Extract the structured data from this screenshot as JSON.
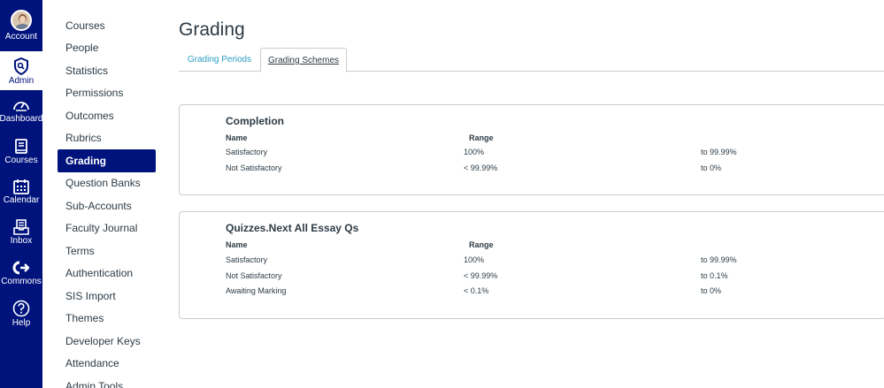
{
  "global_nav": {
    "account_label": "Account",
    "admin_label": "Admin",
    "dashboard_label": "Dashboard",
    "courses_label": "Courses",
    "calendar_label": "Calendar",
    "inbox_label": "Inbox",
    "commons_label": "Commons",
    "help_label": "Help"
  },
  "sub_nav": {
    "items": [
      "Courses",
      "People",
      "Statistics",
      "Permissions",
      "Outcomes",
      "Rubrics",
      "Grading",
      "Question Banks",
      "Sub-Accounts",
      "Faculty Journal",
      "Terms",
      "Authentication",
      "SIS Import",
      "Themes",
      "Developer Keys",
      "Attendance",
      "Admin Tools"
    ],
    "active": "Grading"
  },
  "page": {
    "title": "Grading"
  },
  "tabs": {
    "grading_periods": "Grading Periods",
    "grading_schemes": "Grading Schemes"
  },
  "schemes": [
    {
      "title": "Completion",
      "name_header": "Name",
      "range_header": "Range",
      "rows": [
        {
          "name": "Satisfactory",
          "min": "100%",
          "max": "to 99.99%"
        },
        {
          "name": "Not Satisfactory",
          "min": "< 99.99%",
          "max": "to 0%"
        }
      ]
    },
    {
      "title": "Quizzes.Next All Essay Qs",
      "name_header": "Name",
      "range_header": "Range",
      "rows": [
        {
          "name": "Satisfactory",
          "min": "100%",
          "max": "to 99.99%"
        },
        {
          "name": "Not Satisfactory",
          "min": "< 99.99%",
          "max": "to 0.1%"
        },
        {
          "name": "Awaiting Marking",
          "min": "< 0.1%",
          "max": "to 0%"
        }
      ]
    }
  ],
  "colors": {
    "nav_bg": "#00137d",
    "link": "#2a9ec2",
    "text": "#2d3b45",
    "border": "#c7cdd1"
  },
  "icons": [
    "avatar",
    "shield-icon",
    "dashboard-icon",
    "courses-icon",
    "calendar-icon",
    "inbox-icon",
    "commons-icon",
    "help-icon"
  ]
}
